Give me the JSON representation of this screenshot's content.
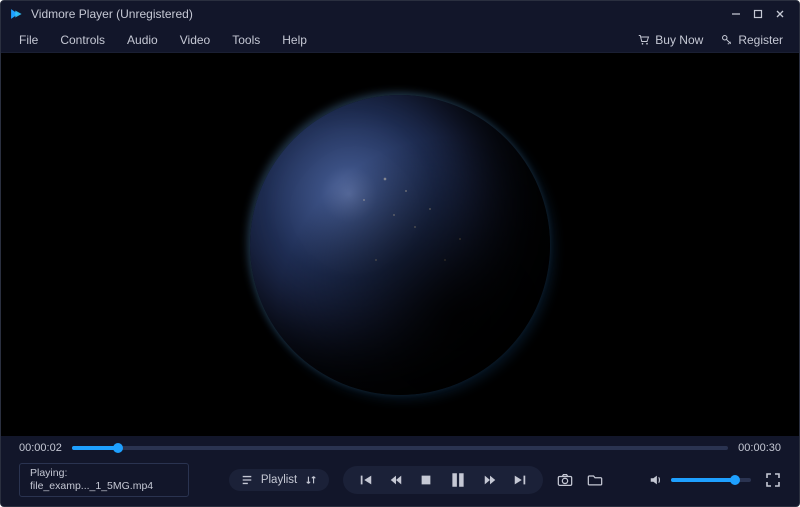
{
  "title": "Vidmore Player (Unregistered)",
  "menu": {
    "items": [
      "File",
      "Controls",
      "Audio",
      "Video",
      "Tools",
      "Help"
    ],
    "buy_now": "Buy Now",
    "register": "Register"
  },
  "progress": {
    "current": "00:00:02",
    "duration": "00:00:30",
    "percent": 7
  },
  "now_playing": {
    "label": "Playing:",
    "filename": "file_examp..._1_5MG.mp4"
  },
  "playlist": {
    "label": "Playlist"
  },
  "volume": {
    "percent": 80
  },
  "colors": {
    "accent": "#1ea0ff"
  }
}
